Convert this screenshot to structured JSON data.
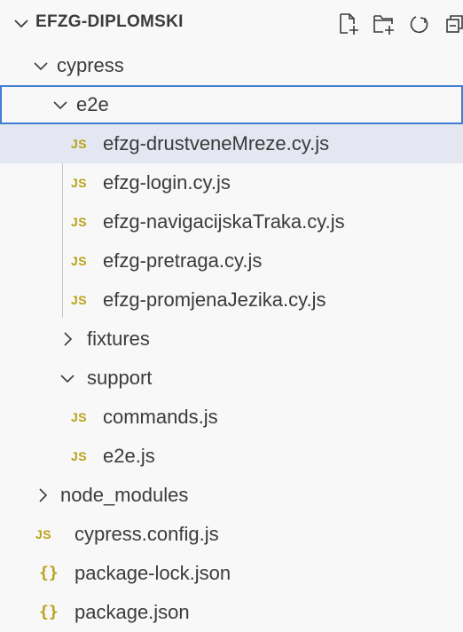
{
  "explorer": {
    "title": "EFZG-DIPLOMSKI",
    "actions": [
      {
        "name": "new-file-icon"
      },
      {
        "name": "new-folder-icon"
      },
      {
        "name": "refresh-icon"
      },
      {
        "name": "collapse-all-icon"
      }
    ],
    "tree": [
      {
        "label": "cypress",
        "kind": "folder",
        "expanded": true
      },
      {
        "label": "e2e",
        "kind": "folder",
        "expanded": true
      },
      {
        "label": "efzg-drustveneMreze.cy.js",
        "kind": "js",
        "icon_text": "JS"
      },
      {
        "label": "efzg-login.cy.js",
        "kind": "js",
        "icon_text": "JS"
      },
      {
        "label": "efzg-navigacijskaTraka.cy.js",
        "kind": "js",
        "icon_text": "JS"
      },
      {
        "label": "efzg-pretraga.cy.js",
        "kind": "js",
        "icon_text": "JS"
      },
      {
        "label": "efzg-promjenaJezika.cy.js",
        "kind": "js",
        "icon_text": "JS"
      },
      {
        "label": "fixtures",
        "kind": "folder",
        "expanded": false
      },
      {
        "label": "support",
        "kind": "folder",
        "expanded": true
      },
      {
        "label": "commands.js",
        "kind": "js",
        "icon_text": "JS"
      },
      {
        "label": "e2e.js",
        "kind": "js",
        "icon_text": "JS"
      },
      {
        "label": "node_modules",
        "kind": "folder",
        "expanded": false
      },
      {
        "label": "cypress.config.js",
        "kind": "js",
        "icon_text": "JS"
      },
      {
        "label": "package-lock.json",
        "kind": "json",
        "icon_text": "{}"
      },
      {
        "label": "package.json",
        "kind": "json",
        "icon_text": "{}"
      }
    ]
  },
  "colors": {
    "js_icon": "#b8a218",
    "selected_bg": "#e4e6f1",
    "focus_border": "#3f7ed1"
  }
}
